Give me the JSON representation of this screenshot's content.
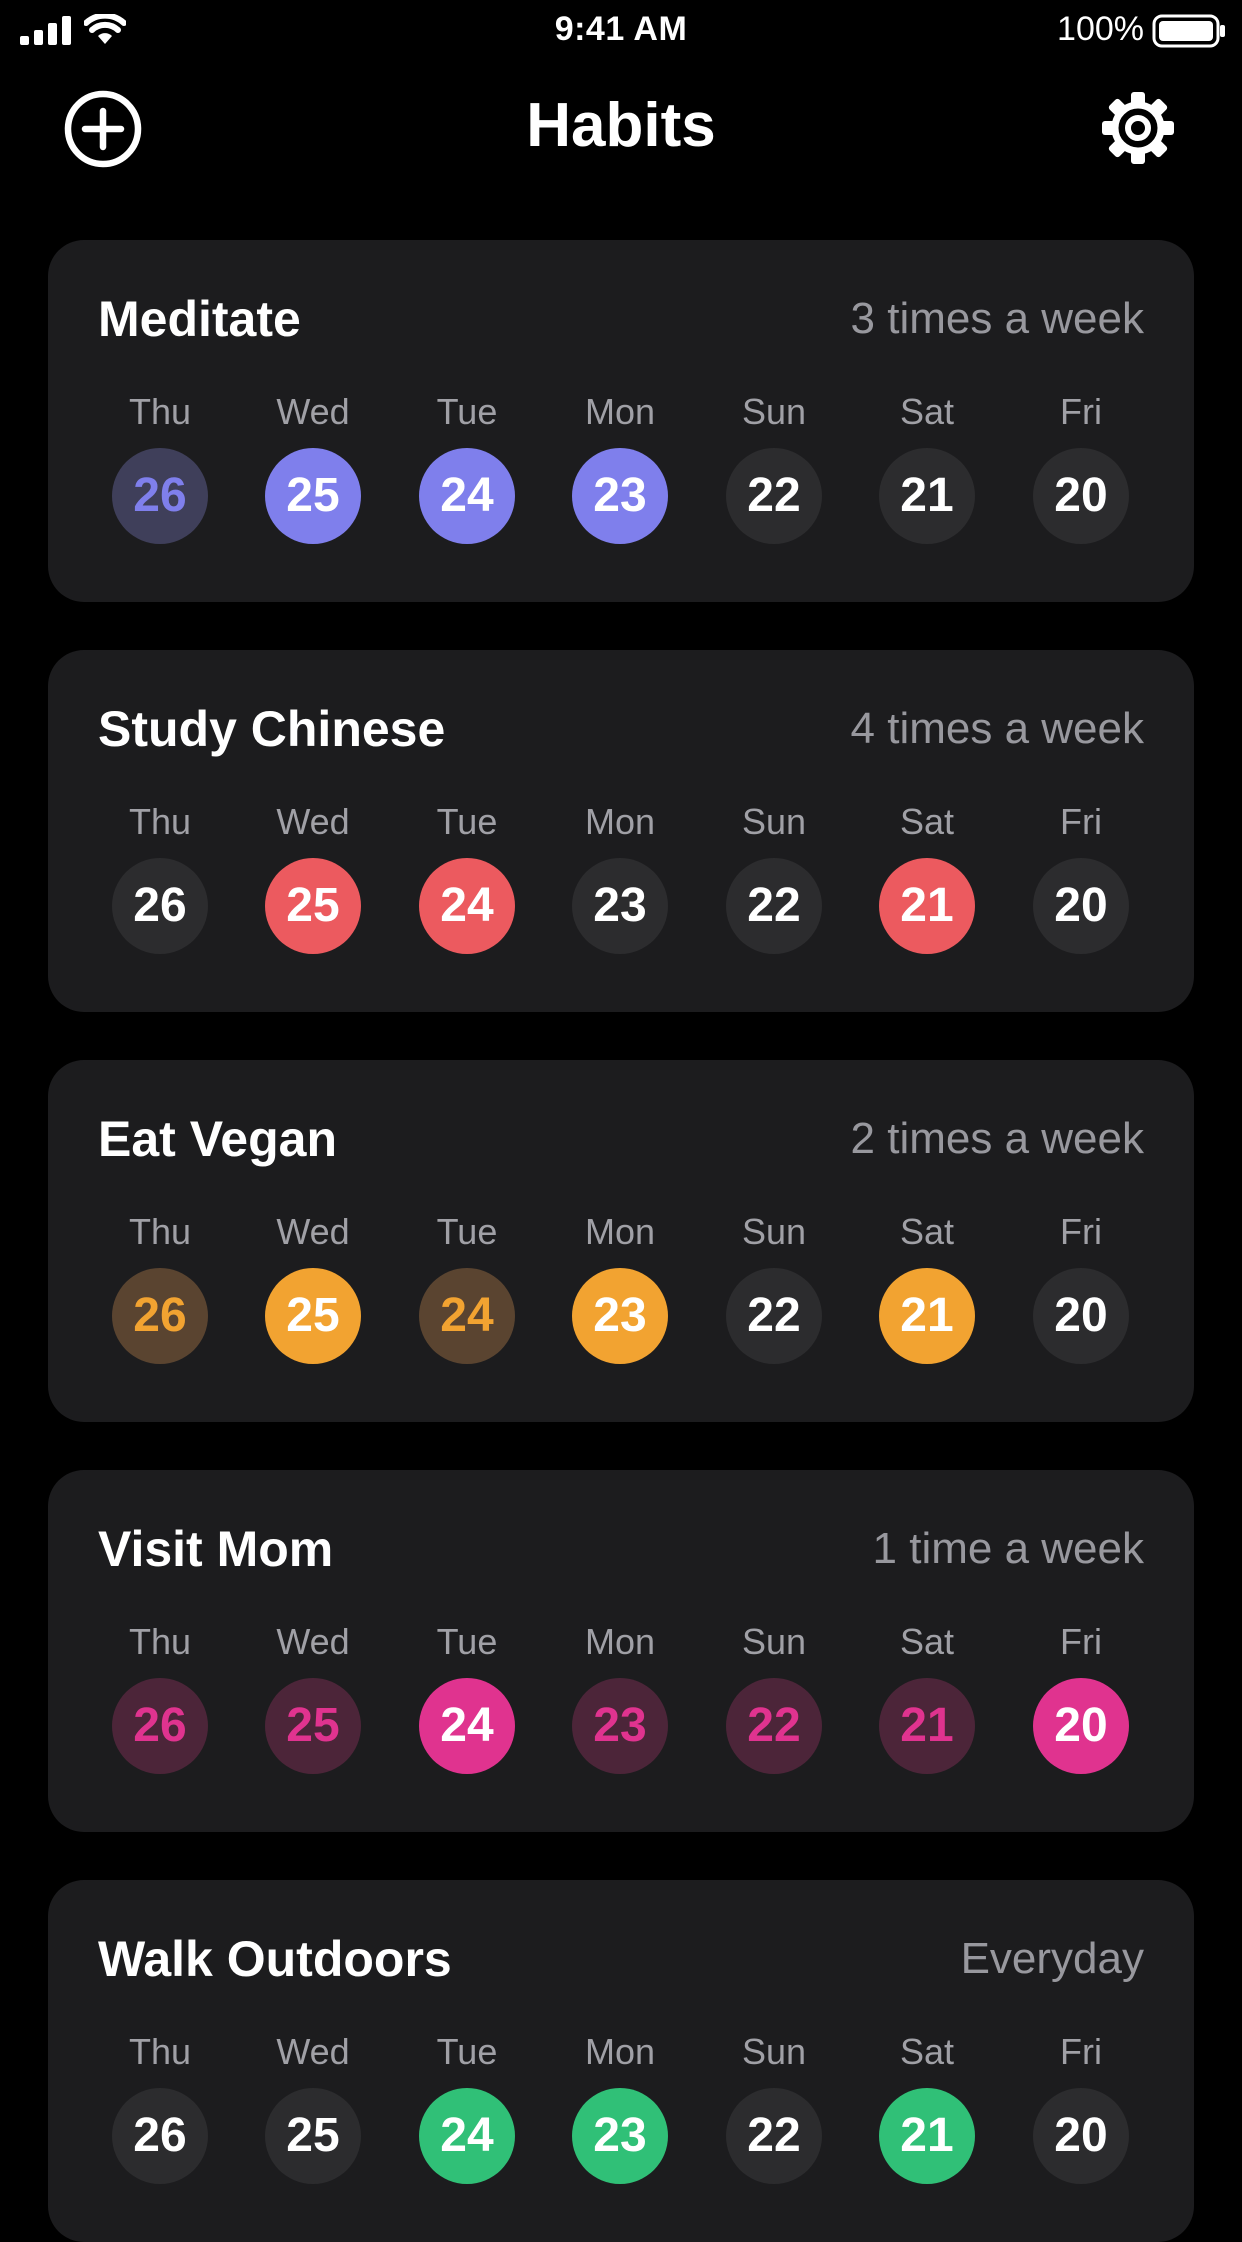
{
  "status_bar": {
    "time": "9:41 AM",
    "battery_pct": "100%",
    "icons": [
      "signal-icon",
      "wifi-icon",
      "battery-icon"
    ]
  },
  "nav": {
    "title": "Habits",
    "add_icon": "plus-circle-icon",
    "settings_icon": "gear-icon"
  },
  "colors": {
    "background": "#000000",
    "card": "#1c1c1e",
    "empty_day": "#2c2c2e",
    "meditate": "#7f7fec",
    "meditate_dim": "#3f3f5a",
    "study_chinese": "#ec5a5f",
    "eat_vegan": "#f2a331",
    "eat_vegan_dim": "#5a4430",
    "visit_mom": "#e0338f",
    "visit_mom_dim": "#4c2539",
    "walk_outdoors": "#30c077"
  },
  "habits": [
    {
      "name": "Meditate",
      "frequency": "3 times a week",
      "days": [
        {
          "label": "Thu",
          "date": "26",
          "state": "dim"
        },
        {
          "label": "Wed",
          "date": "25",
          "state": "done"
        },
        {
          "label": "Tue",
          "date": "24",
          "state": "done"
        },
        {
          "label": "Mon",
          "date": "23",
          "state": "done"
        },
        {
          "label": "Sun",
          "date": "22",
          "state": "empty"
        },
        {
          "label": "Sat",
          "date": "21",
          "state": "empty"
        },
        {
          "label": "Fri",
          "date": "20",
          "state": "empty"
        }
      ]
    },
    {
      "name": "Study Chinese",
      "frequency": "4 times a week",
      "days": [
        {
          "label": "Thu",
          "date": "26",
          "state": "empty"
        },
        {
          "label": "Wed",
          "date": "25",
          "state": "done"
        },
        {
          "label": "Tue",
          "date": "24",
          "state": "done"
        },
        {
          "label": "Mon",
          "date": "23",
          "state": "empty"
        },
        {
          "label": "Sun",
          "date": "22",
          "state": "empty"
        },
        {
          "label": "Sat",
          "date": "21",
          "state": "done"
        },
        {
          "label": "Fri",
          "date": "20",
          "state": "empty"
        }
      ]
    },
    {
      "name": "Eat Vegan",
      "frequency": "2 times a week",
      "days": [
        {
          "label": "Thu",
          "date": "26",
          "state": "dim"
        },
        {
          "label": "Wed",
          "date": "25",
          "state": "done"
        },
        {
          "label": "Tue",
          "date": "24",
          "state": "dim"
        },
        {
          "label": "Mon",
          "date": "23",
          "state": "done"
        },
        {
          "label": "Sun",
          "date": "22",
          "state": "empty"
        },
        {
          "label": "Sat",
          "date": "21",
          "state": "done"
        },
        {
          "label": "Fri",
          "date": "20",
          "state": "empty"
        }
      ]
    },
    {
      "name": "Visit Mom",
      "frequency": "1 time a week",
      "days": [
        {
          "label": "Thu",
          "date": "26",
          "state": "dim"
        },
        {
          "label": "Wed",
          "date": "25",
          "state": "dim"
        },
        {
          "label": "Tue",
          "date": "24",
          "state": "done"
        },
        {
          "label": "Mon",
          "date": "23",
          "state": "dim"
        },
        {
          "label": "Sun",
          "date": "22",
          "state": "dim"
        },
        {
          "label": "Sat",
          "date": "21",
          "state": "dim"
        },
        {
          "label": "Fri",
          "date": "20",
          "state": "done"
        }
      ]
    },
    {
      "name": "Walk Outdoors",
      "frequency": "Everyday",
      "days": [
        {
          "label": "Thu",
          "date": "26",
          "state": "empty"
        },
        {
          "label": "Wed",
          "date": "25",
          "state": "empty"
        },
        {
          "label": "Tue",
          "date": "24",
          "state": "done"
        },
        {
          "label": "Mon",
          "date": "23",
          "state": "done"
        },
        {
          "label": "Sun",
          "date": "22",
          "state": "empty"
        },
        {
          "label": "Sat",
          "date": "21",
          "state": "done"
        },
        {
          "label": "Fri",
          "date": "20",
          "state": "empty"
        }
      ]
    }
  ]
}
